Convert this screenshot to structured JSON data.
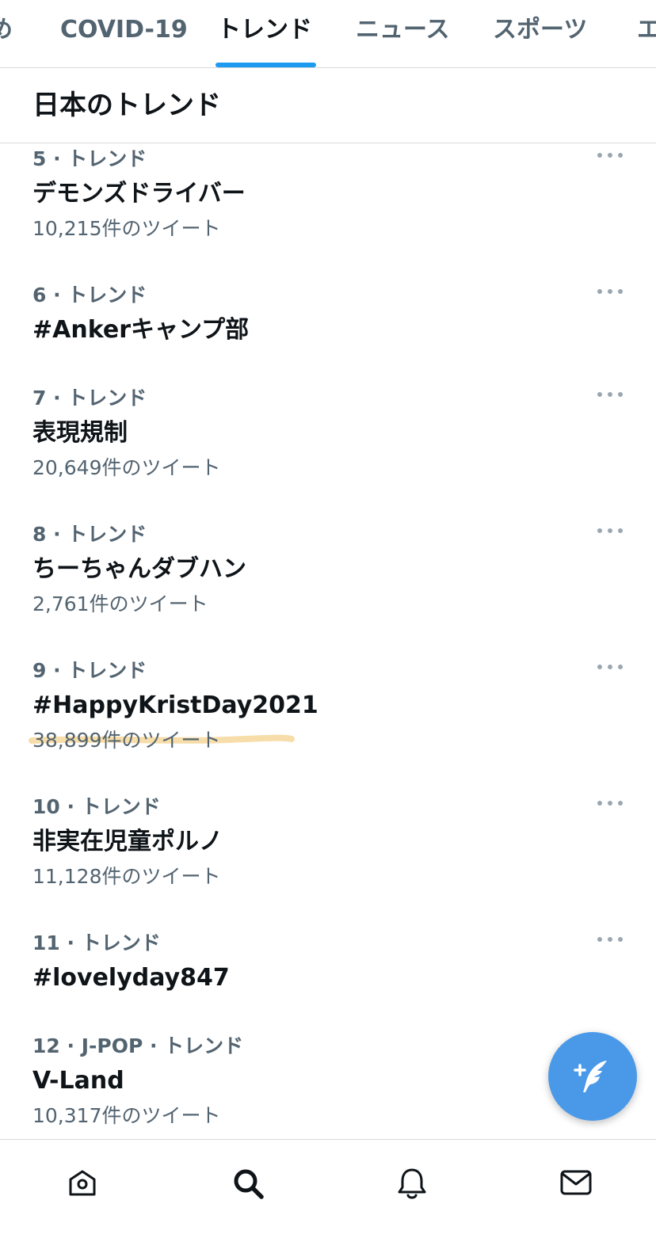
{
  "tabs": [
    {
      "label": "め",
      "active": false
    },
    {
      "label": "COVID-19",
      "active": false
    },
    {
      "label": "トレンド",
      "active": true
    },
    {
      "label": "ニュース",
      "active": false
    },
    {
      "label": "スポーツ",
      "active": false
    },
    {
      "label": "エ",
      "active": false
    }
  ],
  "section": {
    "title": "日本のトレンド"
  },
  "trends": [
    {
      "meta": "5 · トレンド",
      "name": "デモンズドライバー",
      "count": "10,215件のツイート"
    },
    {
      "meta": "6 · トレンド",
      "name": "#Ankerキャンプ部",
      "count": ""
    },
    {
      "meta": "7 · トレンド",
      "name": "表現規制",
      "count": "20,649件のツイート"
    },
    {
      "meta": "8 · トレンド",
      "name": "ちーちゃんダブハン",
      "count": "2,761件のツイート"
    },
    {
      "meta": "9 · トレンド",
      "name": "#HappyKristDay2021",
      "count": "38,899件のツイート",
      "highlighted": true
    },
    {
      "meta": "10 · トレンド",
      "name": "非実在児童ポルノ",
      "count": "11,128件のツイート"
    },
    {
      "meta": "11 · トレンド",
      "name": "#lovelyday847",
      "count": ""
    },
    {
      "meta": "12 · J-POP · トレンド",
      "name": "V-Land",
      "count": "10,317件のツイート"
    }
  ],
  "fab": {
    "icon": "compose-tweet-icon"
  },
  "bottom_nav": [
    {
      "icon": "home-icon",
      "active": false
    },
    {
      "icon": "search-icon",
      "active": true
    },
    {
      "icon": "notifications-bell-icon",
      "active": false
    },
    {
      "icon": "messages-envelope-icon",
      "active": false
    }
  ],
  "colors": {
    "accent": "#1d9bf0",
    "fab": "#4a99e9",
    "secondary_text": "#536471",
    "primary_text": "#0f1419",
    "highlight_marker": "#f5d9a0"
  }
}
